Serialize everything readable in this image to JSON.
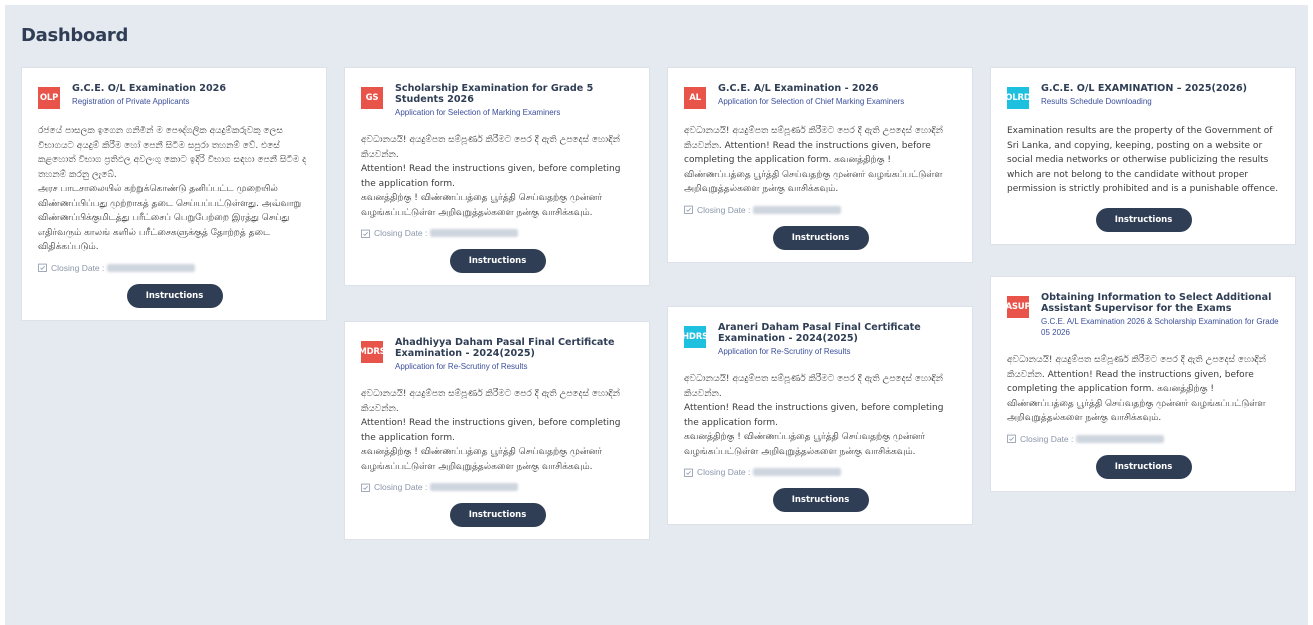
{
  "page": {
    "title": "Dashboard"
  },
  "cards": [
    {
      "badge": "OLP",
      "badge_color": "#e8534a",
      "title": "G.C.E. O/L Examination 2026",
      "subtitle": "Registration of Private Applicants",
      "body": [
        "රජයේ පාසලක ඉගෙන ගනිමින් ම පෞද්ගලික අයදුම්කරුවකු ලෙස විභාගයට අයදුම් කිරීම හෝ පෙනී සිටීම සපුරා තහනම් වේ. එසේ කළහොත් විභාග ප්‍රතිඵල අවලංගු කොට ඉදිරි විභාග සඳහා පෙනී සිටීම ද තහනම් කරනු ලැබේ.",
        "அரச பாடசாலையில் கற்றுக்கொண்டு தனிப்பட்ட முறையில் விண்ணப்பிப்பது முற்றாகத் தடை செய்யப்பட்டுள்ளது. அவ்வாறு விண்ணப்பிக்குமிடத்து பரீட்சைப் பெறுபேற்றை இரத்து செய்து எதிர்வரும் காலங் களில் பரீட்சைகளுக்குத் தோற்றத் தடை விதிக்கப்படும்."
      ],
      "closing_label": "Closing Date :",
      "button": "Instructions"
    },
    {
      "badge": "GS",
      "badge_color": "#e8534a",
      "title": "Scholarship Examination for Grade 5 Students 2026",
      "subtitle": "Application for Selection of Marking Examiners",
      "body": [
        "අවධානයයි! අයදුම්පත සම්පූර්ණ කිරීමට පෙර දී ඇති උපදෙස් හොඳින් කියවන්න.",
        "Attention! Read the instructions given, before completing the application form.",
        "கவனத்திற்கு ! விண்ணப்பத்தை பூர்த்தி செய்வதற்கு முன்னர் வழங்கப்பட்டுள்ள அறிவுறுத்தல்களை நன்கு வாசிக்கவும்."
      ],
      "closing_label": "Closing Date :",
      "button": "Instructions"
    },
    {
      "badge": "MDRS",
      "badge_color": "#e8534a",
      "title": "Ahadhiyya Daham Pasal Final Certificate Examination - 2024(2025)",
      "subtitle": "Application for Re-Scrutiny of Results",
      "body": [
        "අවධානයයි! අයදුම්පත සම්පූර්ණ කිරීමට පෙර දී ඇති උපදෙස් හොඳින් කියවන්න.",
        "Attention! Read the instructions given, before completing the application form.",
        "கவனத்திற்கு ! விண்ணப்பத்தை பூர்த்தி செய்வதற்கு முன்னர் வழங்கப்பட்டுள்ள அறிவுறுத்தல்களை நன்கு வாசிக்கவும்."
      ],
      "closing_label": "Closing Date :",
      "button": "Instructions"
    },
    {
      "badge": "AL",
      "badge_color": "#e8534a",
      "title": "G.C.E. A/L Examination - 2026",
      "subtitle": "Application for Selection of Chief Marking Examiners",
      "body": [
        "අවධානයයි! අයදුම්පත සම්පූර්ණ කිරීමට පෙර දී ඇති උපදෙස් හොඳින් කියවන්න. Attention! Read the instructions given, before completing the application form. கவனத்திற்கு !",
        "விண்ணப்பத்தை பூர்த்தி செய்வதற்கு முன்னர் வழங்கப்பட்டுள்ள அறிவுறுத்தல்களை நன்கு வாசிக்கவும்."
      ],
      "closing_label": "Closing Date :",
      "button": "Instructions"
    },
    {
      "badge": "HDRS",
      "badge_color": "#1ec0e0",
      "title": "Araneri Daham Pasal Final Certificate Examination - 2024(2025)",
      "subtitle": "Application for Re-Scrutiny of Results",
      "body": [
        "අවධානයයි! අයදුම්පත සම්පූර්ණ කිරීමට පෙර දී ඇති උපදෙස් හොඳින් කියවන්න.",
        "Attention! Read the instructions given, before completing the application form.",
        "கவனத்திற்கு ! விண்ணப்பத்தை பூர்த்தி செய்வதற்கு முன்னர் வழங்கப்பட்டுள்ள அறிவுறுத்தல்களை நன்கு வாசிக்கவும்."
      ],
      "closing_label": "Closing Date :",
      "button": "Instructions"
    },
    {
      "badge": "OLRD",
      "badge_color": "#1ec0e0",
      "title": "G.C.E. O/L EXAMINATION – 2025(2026)",
      "subtitle": "Results Schedule Downloading",
      "body": [
        "Examination results are the property of the Government of Sri Lanka, and copying, keeping, posting on a website or social media networks or otherwise publicizing the results which are not belong to the candidate without proper permission is strictly prohibited and is a punishable offence."
      ],
      "closing_label": "",
      "button": "Instructions"
    },
    {
      "badge": "ASUP",
      "badge_color": "#e8534a",
      "title": "Obtaining Information to Select Additional Assistant Supervisor for the Exams",
      "subtitle": "G.C.E. A/L Examination 2026 & Scholarship Examination for Grade 05 2026",
      "body": [
        "අවධානයයි! අයදුම්පත සම්පූර්ණ කිරීමට පෙර දී ඇති උපදෙස් හොඳින් කියවන්න. Attention! Read the instructions given, before completing the application form. கவனத்திற்கு !",
        "விண்ணப்பத்தை பூர்த்தி செய்வதற்கு முன்னர் வழங்கப்பட்டுள்ள அறிவுறுத்தல்களை நன்கு வாசிக்கவும்."
      ],
      "closing_label": "Closing Date :",
      "button": "Instructions"
    }
  ]
}
